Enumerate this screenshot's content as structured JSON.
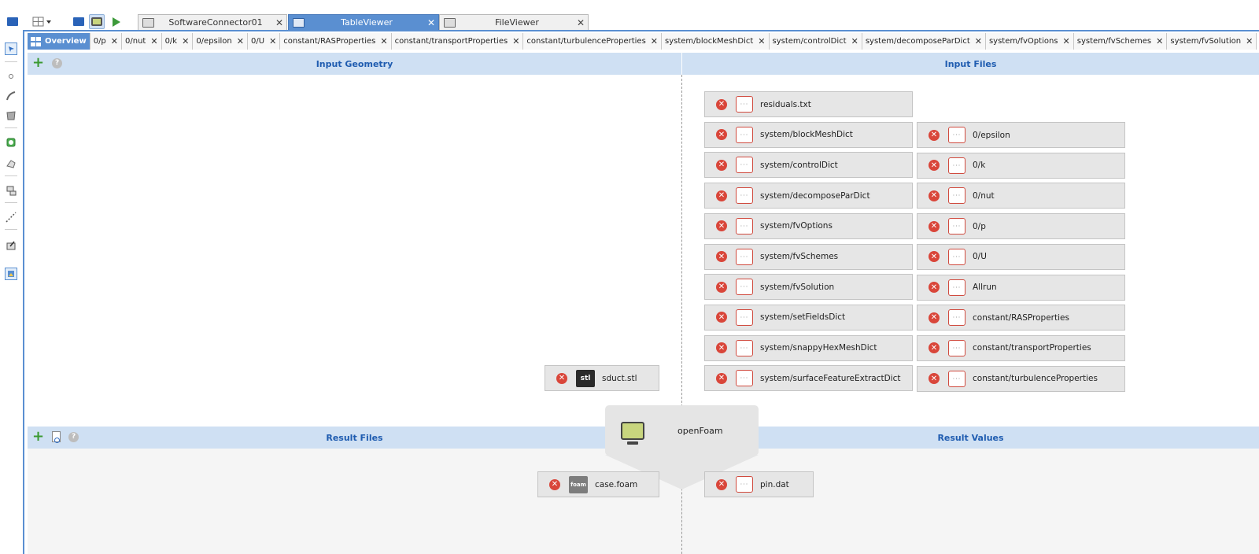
{
  "window_tabs": [
    {
      "label": "SoftwareConnector01",
      "active": false
    },
    {
      "label": "TableViewer",
      "active": true
    },
    {
      "label": "FileViewer",
      "active": false
    }
  ],
  "editor_tabs": [
    "Overview",
    "0/p",
    "0/nut",
    "0/k",
    "0/epsilon",
    "0/U",
    "constant/RASProperties",
    "constant/transportProperties",
    "constant/turbulenceProperties",
    "system/blockMeshDict",
    "system/controlDict",
    "system/decomposeParDict",
    "system/fvOptions",
    "system/fvSchemes",
    "system/fvSolution"
  ],
  "sections": {
    "input_geometry": "Input Geometry",
    "input_files": "Input Files",
    "result_files": "Result Files",
    "result_values": "Result Values"
  },
  "input_files_col1": [
    "residuals.txt",
    "system/blockMeshDict",
    "system/controlDict",
    "system/decomposeParDict",
    "system/fvOptions",
    "system/fvSchemes",
    "system/fvSolution",
    "system/setFieldsDict",
    "system/snappyHexMeshDict",
    "system/surfaceFeatureExtractDict"
  ],
  "input_files_col2": [
    "0/epsilon",
    "0/k",
    "0/nut",
    "0/p",
    "0/U",
    "Allrun",
    "constant/RASProperties",
    "constant/transportProperties",
    "constant/turbulenceProperties"
  ],
  "geometry_file": {
    "name": "sduct.stl",
    "type_badge": "stl"
  },
  "result_file": {
    "name": "case.foam",
    "type_badge": "foam"
  },
  "result_value": {
    "name": "pin.dat"
  },
  "node": {
    "label": "openFoam"
  },
  "glyphs": {
    "close": "✕",
    "remove": "✕",
    "dots": "···",
    "plus": "+",
    "help": "?"
  },
  "colors": {
    "accent": "#5a8fd1",
    "header_bg": "#cfe0f3",
    "header_text": "#1f5cb0",
    "remove_red": "#d9463a",
    "node_green": "#c8d57e"
  }
}
